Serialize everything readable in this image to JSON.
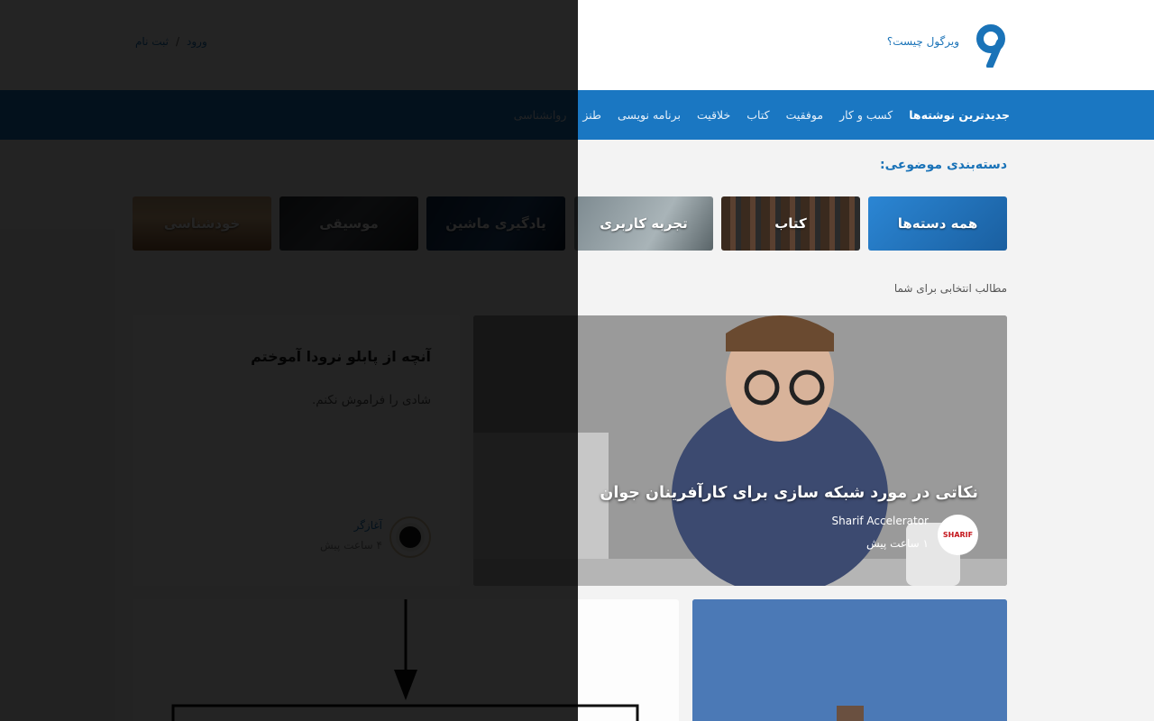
{
  "header": {
    "what_is_label": "ویرگول چیست؟",
    "login_label": "ورود",
    "separator": "/",
    "signup_label": "ثبت نام"
  },
  "nav": {
    "items": [
      {
        "label": "جدیدترین نوشته‌ها",
        "active": true
      },
      {
        "label": "کسب و کار"
      },
      {
        "label": "موفقیت"
      },
      {
        "label": "کتاب"
      },
      {
        "label": "خلاقیت"
      },
      {
        "label": "برنامه نویسی"
      },
      {
        "label": "طنز"
      },
      {
        "label": "روانشناسی"
      }
    ]
  },
  "categories": {
    "title": "دسته‌بندی موضوعی:",
    "items": [
      {
        "label": "همه دسته‌ها"
      },
      {
        "label": "کتاب"
      },
      {
        "label": "تجربه کاربری"
      },
      {
        "label": "یادگیری ماشین"
      },
      {
        "label": "موسیقی"
      },
      {
        "label": "خودشناسی"
      }
    ]
  },
  "picks": {
    "label": "مطالب انتخابی برای شما"
  },
  "featured": {
    "title": "نکاتی در مورد شبکه سازی برای کارآفرینان جوان",
    "author": "Sharif Accelerator",
    "time": "۱ ساعت پیش",
    "avatar_text": "SHARIF"
  },
  "post2": {
    "title": "آنچه از پابلو نرودا آموختم",
    "subtitle": "شادی را فراموش نکنم.",
    "author": "آغازگر",
    "time": "۴ ساعت پیش"
  },
  "colors": {
    "brand": "#1a77c2",
    "overlay": "#000000"
  }
}
